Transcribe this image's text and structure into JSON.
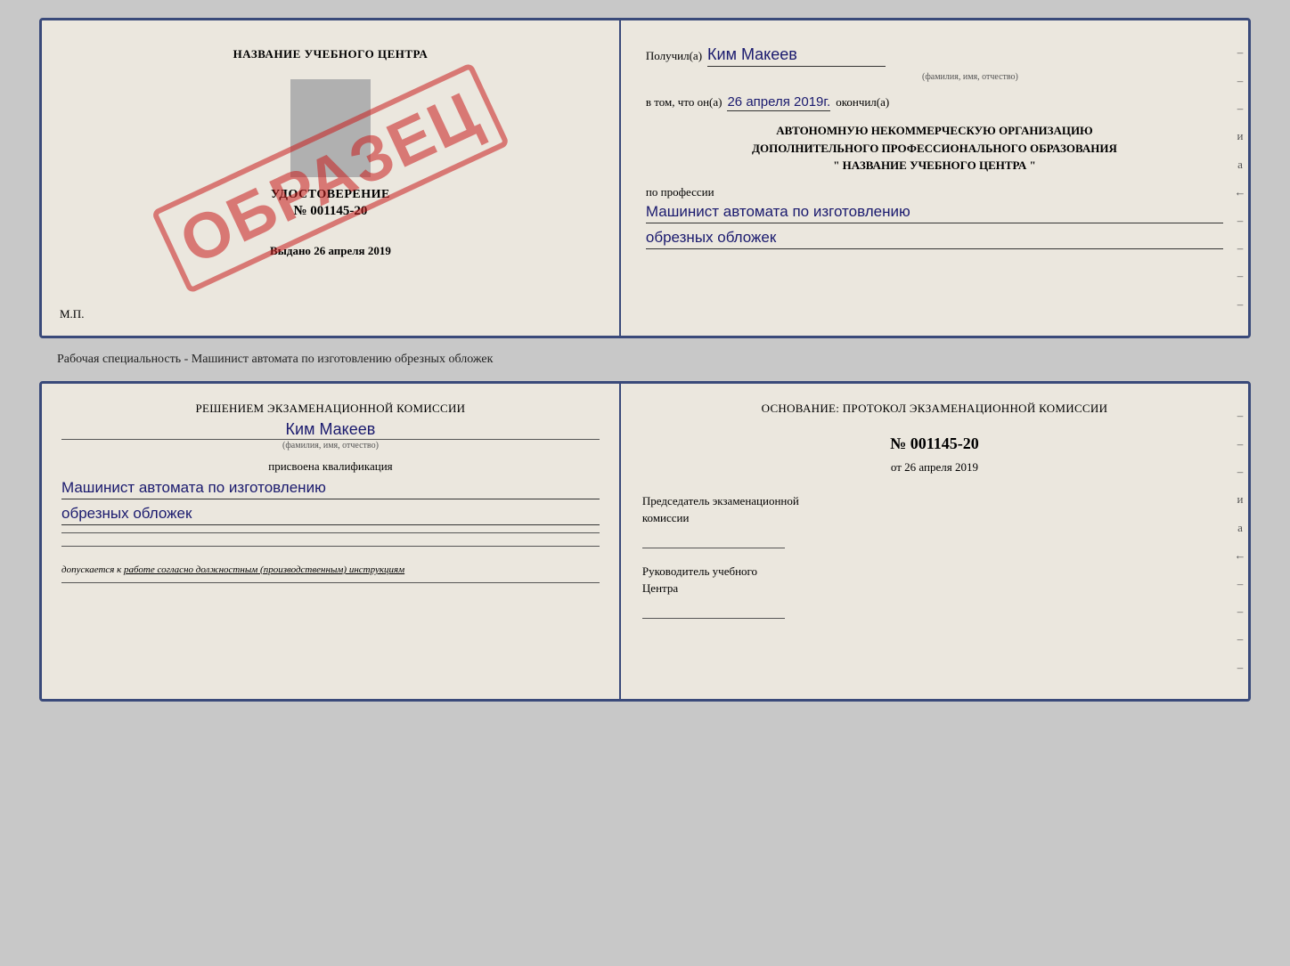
{
  "top_doc": {
    "left": {
      "school_name": "НАЗВАНИЕ УЧЕБНОГО ЦЕНТРА",
      "udostoverenie_title": "УДОСТОВЕРЕНИЕ",
      "number": "№ 001145-20",
      "vydano": "Выдано",
      "vydano_date": "26 апреля 2019",
      "mp": "М.П.",
      "stamp": "ОБРАЗЕЦ"
    },
    "right": {
      "poluchil_label": "Получил(а)",
      "recipient_name": "Ким Макеев",
      "fio_hint": "(фамилия, имя, отчество)",
      "vtom_label": "в том, что он(а)",
      "date_value": "26 апреля 2019г.",
      "okonchil_label": "окончил(а)",
      "org_line1": "АВТОНОМНУЮ НЕКОММЕРЧЕСКУЮ ОРГАНИЗАЦИЮ",
      "org_line2": "ДОПОЛНИТЕЛЬНОГО ПРОФЕССИОНАЛЬНОГО ОБРАЗОВАНИЯ",
      "org_line3": "\" НАЗВАНИЕ УЧЕБНОГО ЦЕНТРА \"",
      "po_professii": "по профессии",
      "profession_line1": "Машинист автомата по изготовлению",
      "profession_line2": "обрезных обложек"
    }
  },
  "caption": "Рабочая специальность - Машинист автомата по изготовлению обрезных обложек",
  "bottom_doc": {
    "left": {
      "reshenie_text": "Решением экзаменационной комиссии",
      "fio_name": "Ким Макеев",
      "fio_hint": "(фамилия, имя, отчество)",
      "prisvoena": "присвоена квалификация",
      "qualification_line1": "Машинист автомата по изготовлению",
      "qualification_line2": "обрезных обложек",
      "dopuskaetsya_prefix": "допускается к",
      "dopuskaetsya_underlined": "работе согласно должностным (производственным) инструкциям"
    },
    "right": {
      "osnovanie_label": "Основание: протокол экзаменационной комиссии",
      "protocol_number": "№ 001145-20",
      "ot_label": "от",
      "protocol_date": "26 апреля 2019",
      "predsedatel_label": "Председатель экзаменационной",
      "komissii_label": "комиссии",
      "rukovoditel_label": "Руководитель учебного",
      "tsentra_label": "Центра"
    }
  },
  "dashes": [
    "-",
    "-",
    "-",
    "и",
    "а",
    "←",
    "-",
    "-",
    "-",
    "-"
  ]
}
